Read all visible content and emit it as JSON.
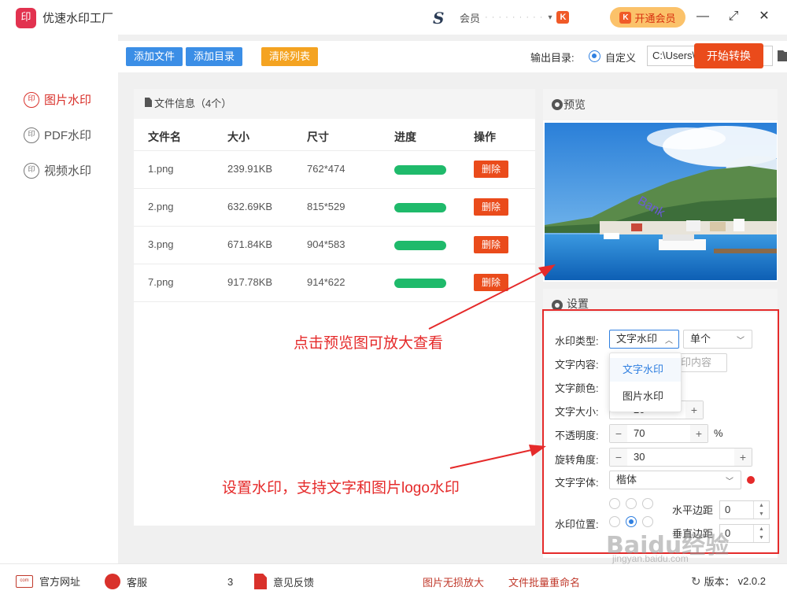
{
  "app": {
    "title": "优速水印工厂",
    "logo_text": "印"
  },
  "titlebar": {
    "member_label": "会员",
    "member_id": "· · · · · · · · ·",
    "vip_button": "开通会员",
    "minimize": "—",
    "maximize": "⤢",
    "close": "✕"
  },
  "sidebar": {
    "items": [
      {
        "label": "图片水印",
        "icon_text": "印",
        "active": true
      },
      {
        "label": "PDF水印",
        "icon_text": "印",
        "active": false
      },
      {
        "label": "视频水印",
        "icon_text": "印",
        "active": false
      }
    ]
  },
  "toolbar": {
    "add_file": "添加文件",
    "add_dir": "添加目录",
    "clear_list": "清除列表",
    "output_label": "输出目录:",
    "radio_custom": "自定义",
    "output_path": "C:\\Users\\admin\\Desktop",
    "start_button": "开始转换"
  },
  "files": {
    "header": "文件信息（4个）",
    "columns": [
      "文件名",
      "大小",
      "尺寸",
      "进度",
      "操作"
    ],
    "rows": [
      {
        "name": "1.png",
        "size": "239.91KB",
        "dims": "762*474",
        "progress": 1.0,
        "action": "删除"
      },
      {
        "name": "2.png",
        "size": "632.69KB",
        "dims": "815*529",
        "progress": 1.0,
        "action": "删除"
      },
      {
        "name": "3.png",
        "size": "671.84KB",
        "dims": "904*583",
        "progress": 1.0,
        "action": "删除"
      },
      {
        "name": "7.png",
        "size": "917.78KB",
        "dims": "914*622",
        "progress": 1.0,
        "action": "删除"
      }
    ]
  },
  "preview": {
    "title": "预览",
    "watermark_text": "Bank"
  },
  "settings": {
    "title": "设置",
    "type_label": "水印类型:",
    "type_value": "文字水印",
    "mode_value": "单个",
    "dropdown_options": [
      "文字水印",
      "图片水印"
    ],
    "content_label": "文字内容:",
    "content_placeholder": "印内容",
    "color_label": "文字颜色:",
    "size_label": "文字大小:",
    "size_value": "20",
    "opacity_label": "不透明度:",
    "opacity_value": "70",
    "opacity_unit": "%",
    "rotate_label": "旋转角度:",
    "rotate_value": "30",
    "font_label": "文字字体:",
    "font_value": "楷体",
    "position_label": "水印位置:",
    "h_margin_label": "水平边距",
    "h_margin_value": "0",
    "v_margin_label": "垂直边距",
    "v_margin_value": "0"
  },
  "annotations": {
    "preview_hint": "点击预览图可放大查看",
    "settings_hint": "设置水印，支持文字和图片logo水印"
  },
  "footer": {
    "website": "官方网址",
    "service": "客服",
    "service_suffix": "3",
    "feedback": "意见反馈",
    "lossless": "图片无损放大",
    "rename": "文件批量重命名",
    "version_label": "版本：",
    "version": "v2.0.2"
  },
  "watermark": {
    "brand": "Baidu经验",
    "url": "jingyan.baidu.com"
  },
  "colors": {
    "accent_red": "#ea4b1b",
    "blue": "#3b8ee6",
    "green": "#1fba6b",
    "annotation": "#e52a2a"
  }
}
